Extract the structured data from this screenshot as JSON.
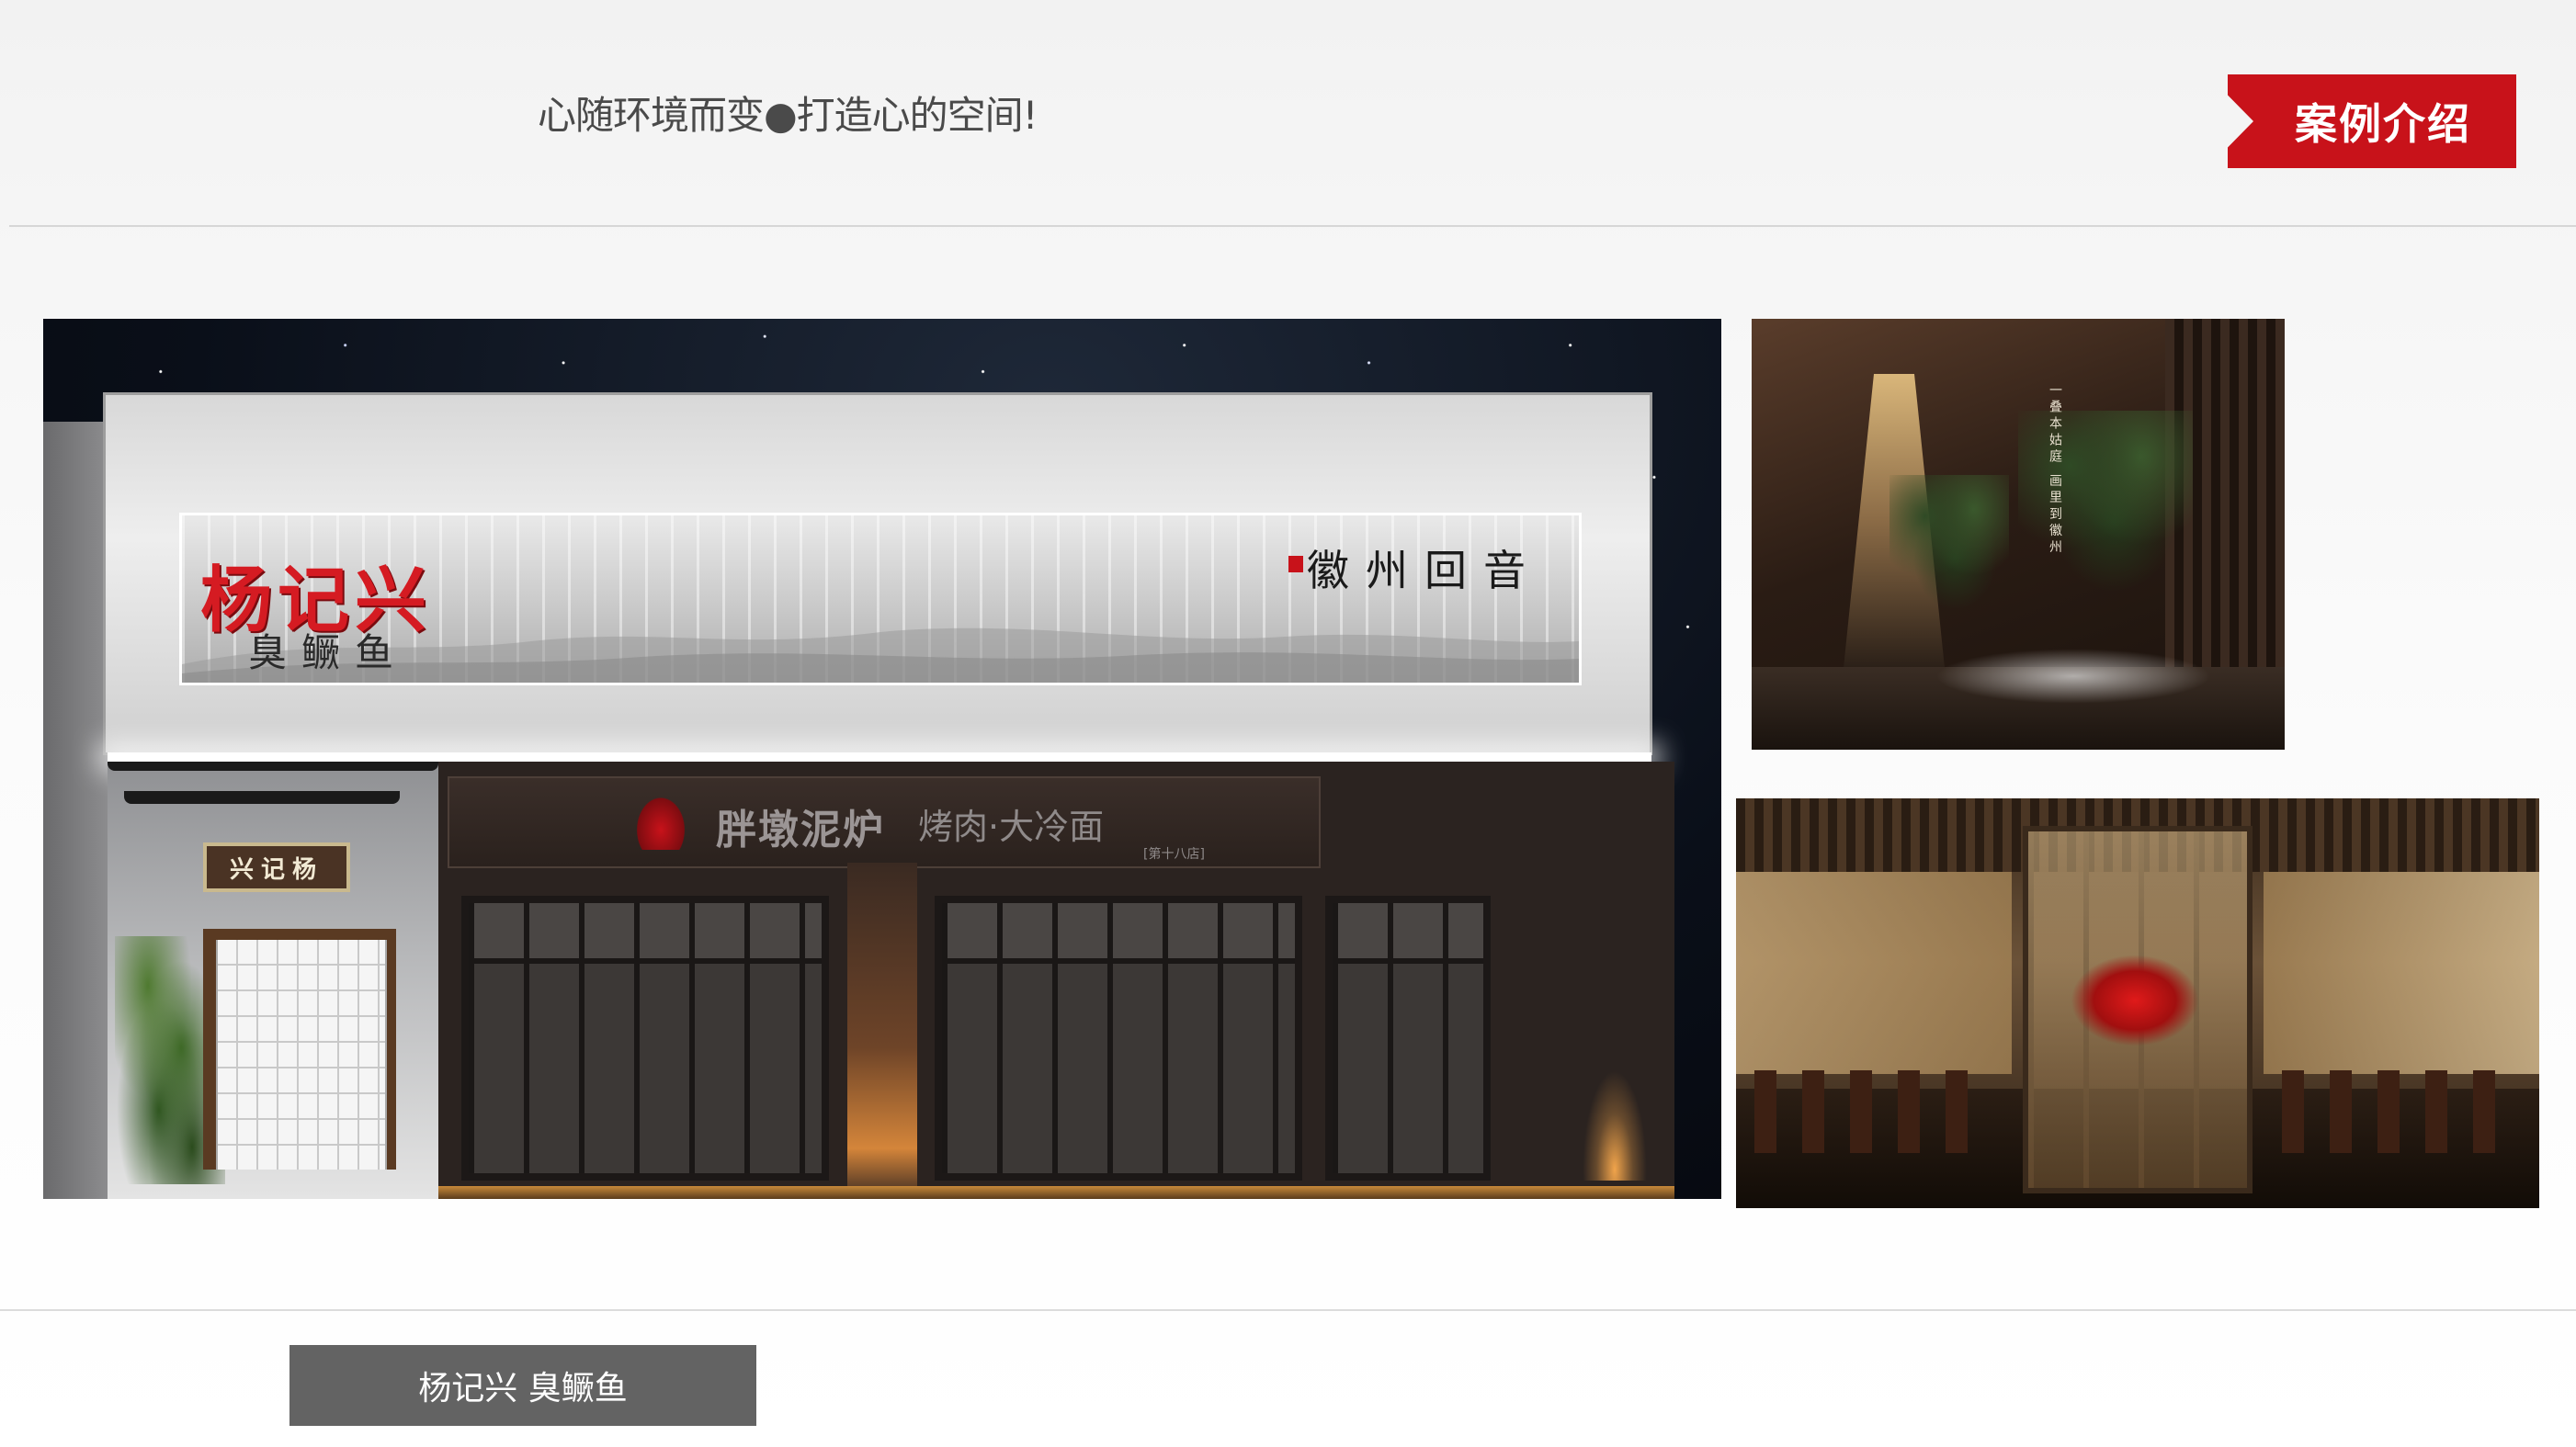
{
  "header": {
    "slogan": "心随环境而变●打造心的空间!",
    "badge_label": "案例介绍",
    "badge_color": "#c8121a"
  },
  "storefront": {
    "brand_name": "杨记兴",
    "brand_sub": "臭鳜鱼",
    "calligraphy": "徽州回音",
    "door_plaque": "兴记杨",
    "shop_name": "胖墩泥炉",
    "shop_tag": "烤肉·大冷面",
    "shop_note": "[第十八店]"
  },
  "courtyard": {
    "vertical_text": "一叠本姑庭 画里到徽州"
  },
  "caption": {
    "label": "杨记兴 臭鳜鱼"
  }
}
